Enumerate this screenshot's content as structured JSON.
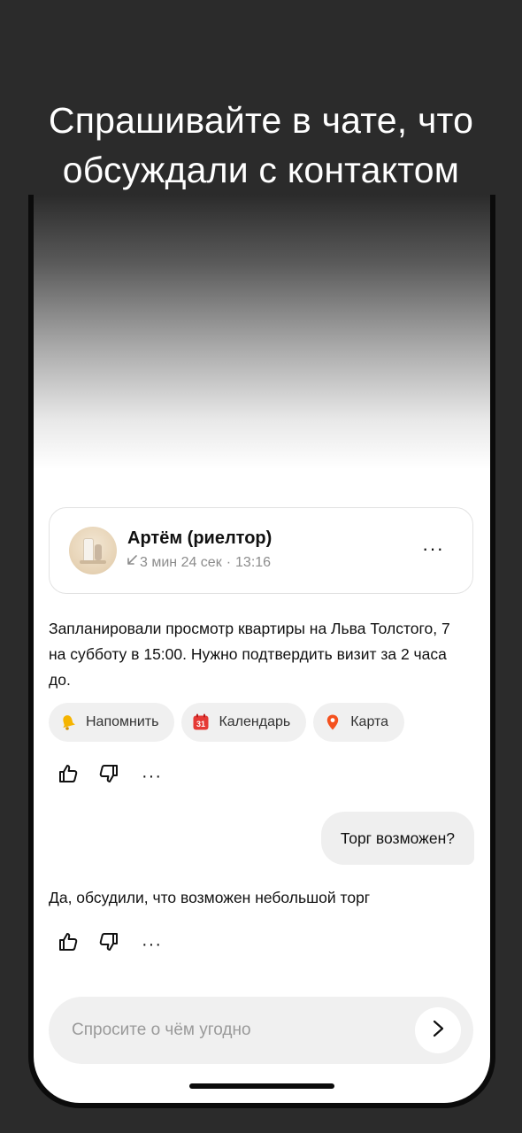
{
  "headline": {
    "line1": "Спрашивайте в чате, что",
    "line2": "обсуждали с контактом"
  },
  "contact": {
    "name": "Артём (риелтор)",
    "duration": "3 мин 24 сек",
    "separator": "·",
    "time": "13:16",
    "more_label": "···"
  },
  "summary_message": "Запланировали просмотр квартиры на Льва Толстого, 7 на субботу в 15:00. Нужно подтвердить визит за 2 часа до.",
  "actions": [
    {
      "label": "Напомнить",
      "icon": "bell-icon"
    },
    {
      "label": "Календарь",
      "icon": "calendar-icon",
      "icon_text": "31"
    },
    {
      "label": "Карта",
      "icon": "map-pin-icon"
    }
  ],
  "reactions": {
    "more_label": "···"
  },
  "user_message": "Торг возможен?",
  "assistant_answer": "Да, обсудили, что возможен небольшой торг",
  "composer": {
    "placeholder": "Спросите о чём угодно"
  },
  "colors": {
    "background": "#2b2b2b",
    "calendar_red": "#e53935",
    "pin_orange": "#f4511e",
    "bell_yellow": "#f5b400"
  }
}
